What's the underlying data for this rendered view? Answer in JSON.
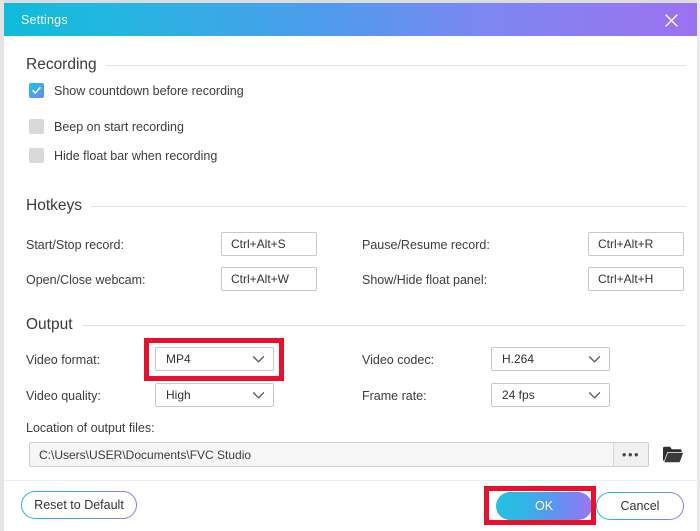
{
  "window": {
    "title": "Settings",
    "close_icon": "close-icon"
  },
  "sections": {
    "recording": {
      "title": "Recording",
      "checkboxes": [
        {
          "label": "Show countdown before recording",
          "checked": true
        },
        {
          "label": "Beep on start recording",
          "checked": false
        },
        {
          "label": "Hide float bar when recording",
          "checked": false
        }
      ]
    },
    "hotkeys": {
      "title": "Hotkeys",
      "fields": [
        {
          "label": "Start/Stop record:",
          "value": "Ctrl+Alt+S"
        },
        {
          "label": "Pause/Resume record:",
          "value": "Ctrl+Alt+R"
        },
        {
          "label": "Open/Close webcam:",
          "value": "Ctrl+Alt+W"
        },
        {
          "label": "Show/Hide float panel:",
          "value": "Ctrl+Alt+H"
        }
      ]
    },
    "output": {
      "title": "Output",
      "video_format": {
        "label": "Video format:",
        "value": "MP4"
      },
      "video_codec": {
        "label": "Video codec:",
        "value": "H.264"
      },
      "video_quality": {
        "label": "Video quality:",
        "value": "High"
      },
      "frame_rate": {
        "label": "Frame rate:",
        "value": "24 fps"
      },
      "location": {
        "label": "Location of output files:",
        "value": "C:\\Users\\USER\\Documents\\FVC Studio",
        "browse_label": "•••",
        "folder_icon": "folder-icon"
      }
    }
  },
  "footer": {
    "reset_label": "Reset to Default",
    "ok_label": "OK",
    "cancel_label": "Cancel"
  },
  "annotations": {
    "highlight_color": "#E8112D",
    "highlighted": [
      "video-format-dropdown",
      "ok-button"
    ]
  },
  "theme": {
    "gradient_start": "#0FBBD9",
    "gradient_end": "#9B72F0",
    "checkbox_accent": "#3FA9F0"
  }
}
